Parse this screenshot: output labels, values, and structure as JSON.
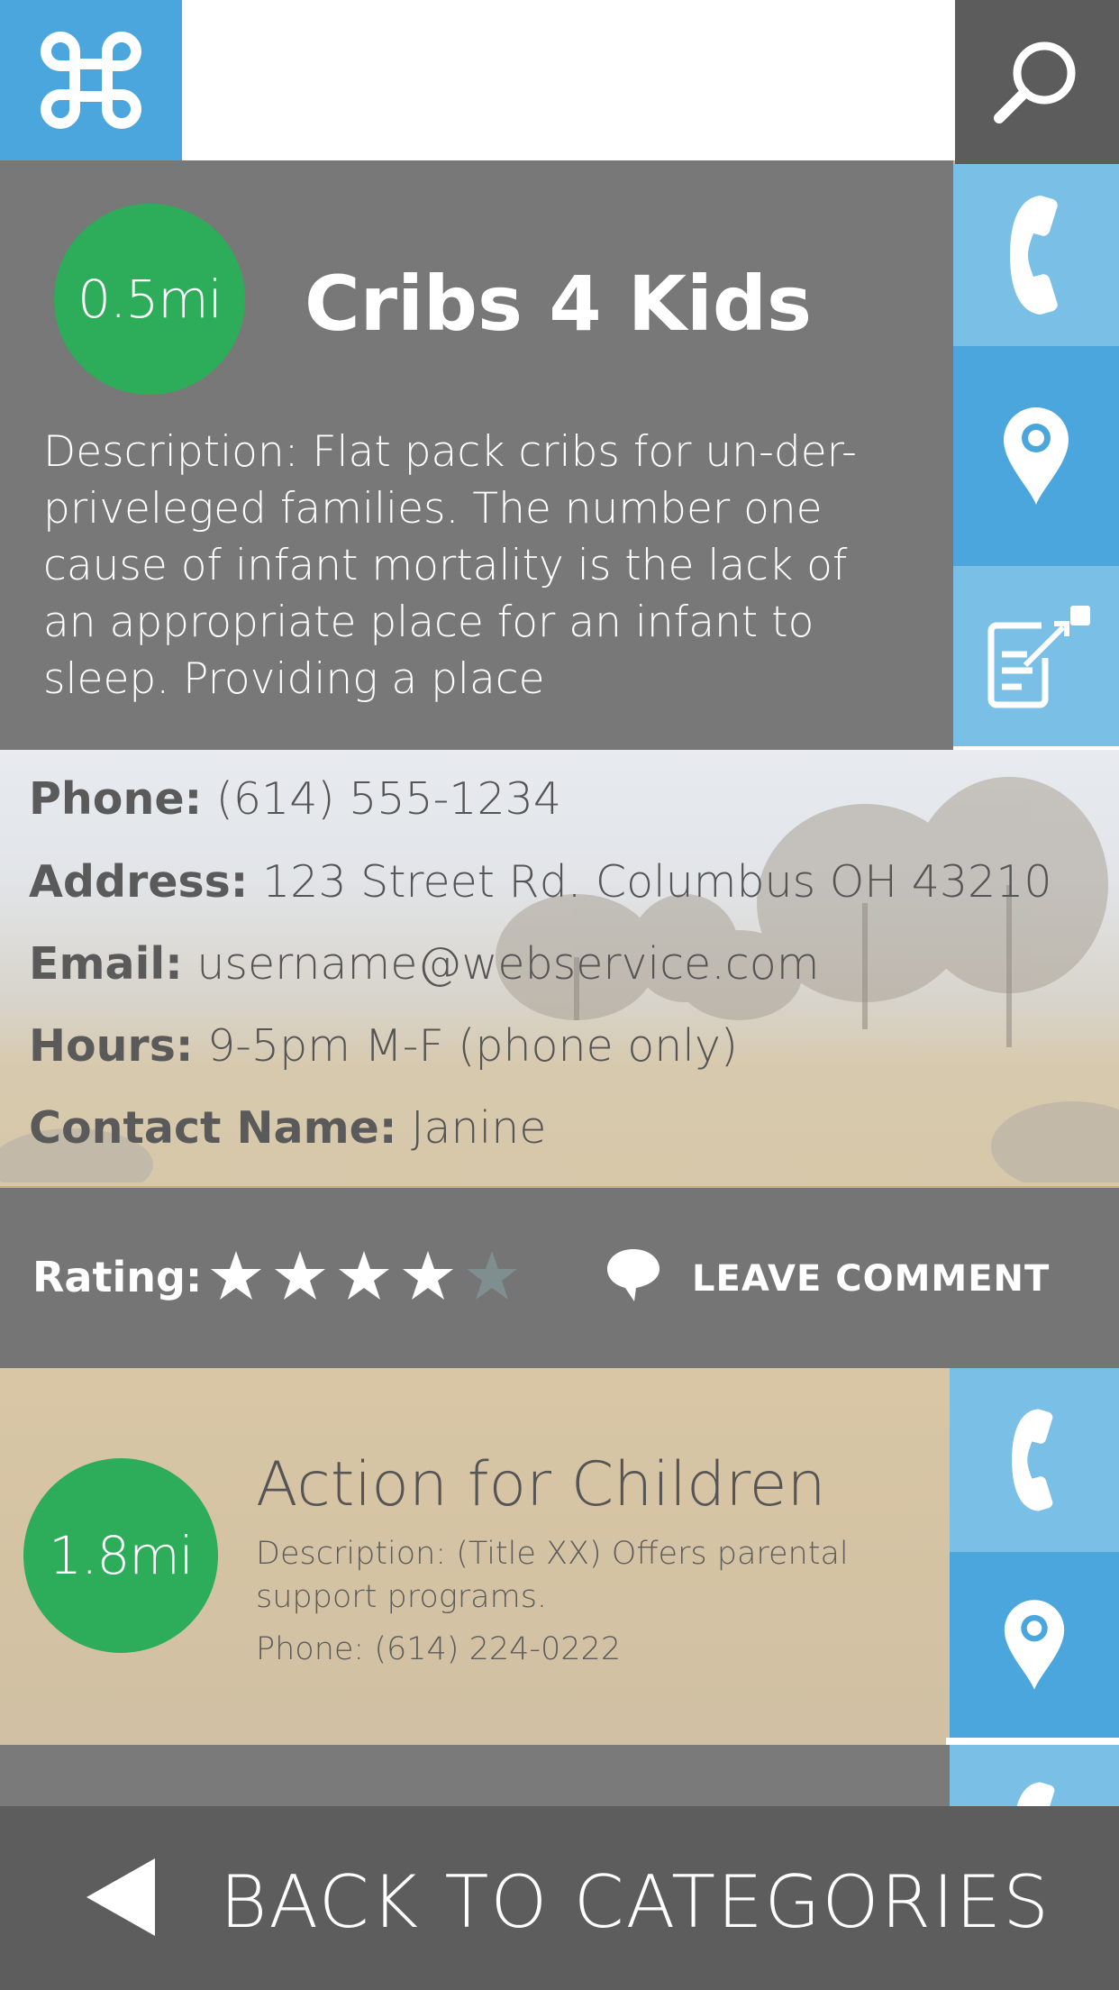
{
  "header": {
    "logo_icon": "command-key-icon",
    "search_icon": "search-icon"
  },
  "featured": {
    "distance": "0.5mi",
    "title": "Cribs 4 Kids",
    "description": "Description: Flat pack cribs for un-der-priveleged families. The number one cause of infant mortality is the lack of an appropriate place for an infant to sleep. Providing a place",
    "actions": [
      "phone-icon",
      "map-pin-icon",
      "edit-note-icon"
    ],
    "details": {
      "phone_label": "Phone:",
      "phone": "(614) 555-1234",
      "address_label": "Address:",
      "address": "123 Street Rd. Columbus OH 43210",
      "email_label": "Email:",
      "email": "username@webservice.com",
      "hours_label": "Hours:",
      "hours": "9-5pm M-F (phone only)",
      "contact_label": "Contact Name:",
      "contact": "Janine"
    },
    "rating_label": "Rating:",
    "rating": 4,
    "rating_max": 5,
    "comment_label": "LEAVE COMMENT"
  },
  "listing2": {
    "distance": "1.8mi",
    "title": "Action for Children",
    "description": "Description: (Title XX) Offers parental support programs.",
    "phone": "Phone: (614) 224-0222"
  },
  "footer": {
    "back_label": "BACK TO CATEGORIES"
  },
  "colors": {
    "accent_blue": "#4aa6dc",
    "light_blue": "#79bfe6",
    "distance_green": "#2dac5a",
    "panel_gray": "#787878",
    "footer_gray": "#5d5d5d"
  }
}
